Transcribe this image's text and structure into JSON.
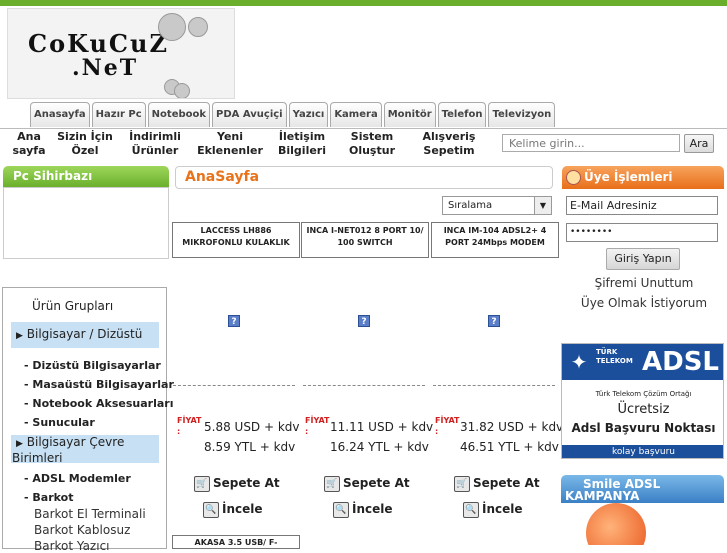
{
  "logo": {
    "line1": "CoKuCuZ",
    "line2": ".NeT"
  },
  "category_tabs": [
    "Anasayfa",
    "Hazır Pc",
    "Notebook",
    "PDA Avuçiçi",
    "Yazıcı",
    "Kamera",
    "Monitör",
    "Telefon",
    "Televizyon"
  ],
  "nav": [
    {
      "l1": "Ana",
      "l2": "sayfa"
    },
    {
      "l1": "Sizin İçin",
      "l2": "Özel"
    },
    {
      "l1": "İndirimli",
      "l2": "Ürünler"
    },
    {
      "l1": "Yeni",
      "l2": "Eklenenler"
    },
    {
      "l1": "İletişim",
      "l2": "Bilgileri"
    },
    {
      "l1": "Sistem",
      "l2": "Oluştur"
    },
    {
      "l1": "Alışveriş",
      "l2": "Sepetim"
    }
  ],
  "search": {
    "placeholder": "Kelime girin...",
    "button": "Ara"
  },
  "pc_wizard": {
    "title": "Pc Sihirbazı"
  },
  "page": {
    "title": "AnaSayfa",
    "sort_label": "Sıralama"
  },
  "products": [
    {
      "name": "LACCESS LH886 MIKROFONLU KULAKLIK",
      "price_label": "FİYAT :",
      "usd": "5.88 USD + kdv",
      "ytl": "8.59 YTL + kdv",
      "add_to_cart": "Sepete At",
      "inspect": "İncele"
    },
    {
      "name": "INCA I-NET012 8 PORT 10/ 100 SWITCH",
      "price_label": "FİYAT :",
      "usd": "11.11 USD + kdv",
      "ytl": "16.24 YTL + kdv",
      "add_to_cart": "Sepete At",
      "inspect": "İncele"
    },
    {
      "name": "INCA IM-104 ADSL2+ 4 PORT 24Mbps MODEM",
      "price_label": "FİYAT :",
      "usd": "31.82 USD + kdv",
      "ytl": "46.51 YTL + kdv",
      "add_to_cart": "Sepete At",
      "inspect": "İncele"
    }
  ],
  "next_product": {
    "name_partial": "AKASA 3.5 USB/ F-"
  },
  "member": {
    "title": "Üye İşlemleri",
    "email_value": "E-Mail Adresiniz",
    "password_mask": "••••••••",
    "login_button": "Giriş Yapın",
    "forgot": "Şifremi Unuttum",
    "register": "Üye Olmak İstiyorum"
  },
  "sidebar": {
    "title": "Ürün Grupları",
    "group1": "Bilgisayar / Dizüstü",
    "group1_items": [
      "- Dizüstü Bilgisayarlar",
      "- Masaüstü Bilgisayarlar",
      "- Notebook Aksesuarları",
      "- Sunucular"
    ],
    "group2_l1": "Bilgisayar Çevre",
    "group2_l2": "Birimleri",
    "group2_items": [
      "- ADSL Modemler",
      "- Barkot"
    ],
    "barkot_items": [
      "Barkot El Terminali",
      "Barkot Kablosuz",
      "Barkot Yazıcı"
    ]
  },
  "adsl_banner": {
    "brand": "TÜRK TELEKOM",
    "adsl": "ADSL",
    "partner": "Türk Telekom Çözüm Ortağı",
    "free": "Ücretsiz",
    "point": "Adsl Başvuru Noktası",
    "footer": "kolay başvuru"
  },
  "campaign": {
    "title_l1": "Smile ADSL",
    "title_l2": "KAMPANYA"
  },
  "colors": {
    "green": "#6aae2b",
    "orange": "#e8731a",
    "blue": "#3b80c6",
    "light_blue": "#c7e0f4"
  }
}
